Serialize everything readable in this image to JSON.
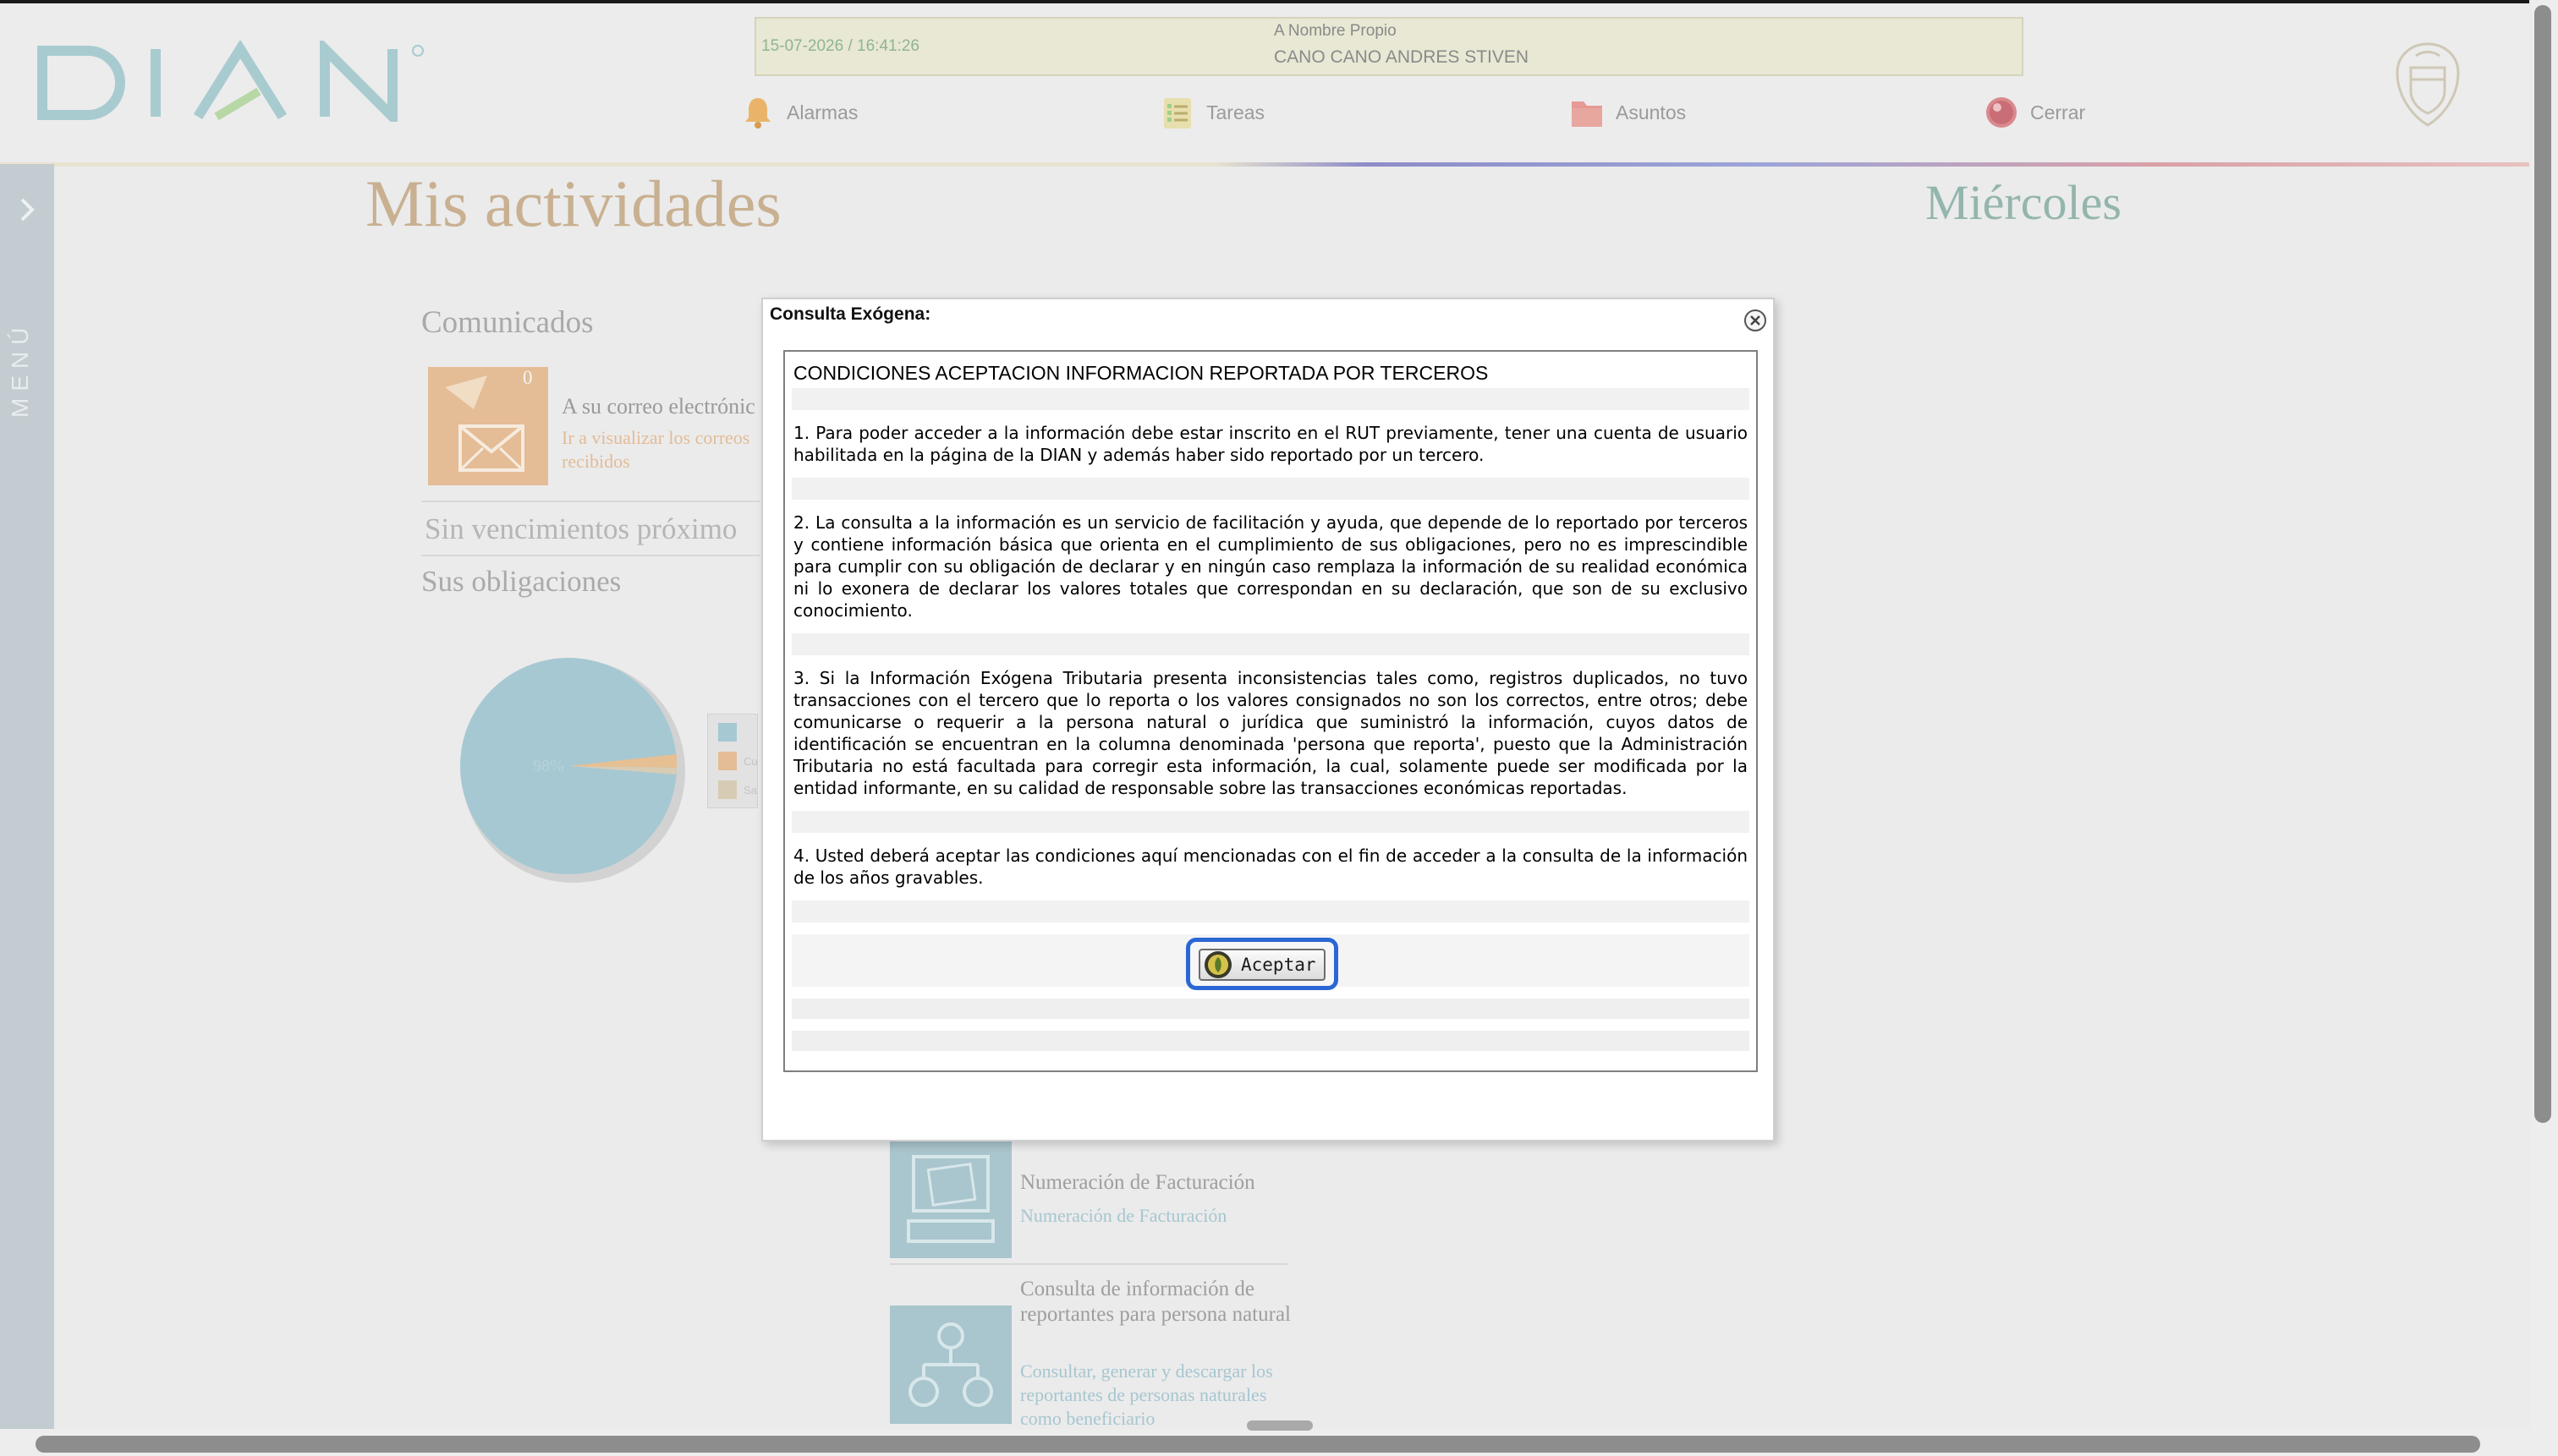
{
  "header": {
    "logo_text": "DIAN",
    "datetime": "15-07-2026 / 16:41:26",
    "role": "A Nombre Propio",
    "user_name": "CANO CANO ANDRES STIVEN",
    "nav": [
      {
        "label": "Alarmas",
        "icon": "bell-icon"
      },
      {
        "label": "Tareas",
        "icon": "checklist-icon"
      },
      {
        "label": "Asuntos",
        "icon": "folder-icon"
      },
      {
        "label": "Cerrar",
        "icon": "power-icon"
      }
    ]
  },
  "sidebar": {
    "label": "MENÚ",
    "icon": "chevron-right-icon"
  },
  "main": {
    "title": "Mis actividades",
    "day": "Miércoles",
    "comunicados": {
      "title": "Comunicados",
      "count": "0",
      "heading": "A su correo electrónic",
      "link": "Ir a visualizar los correos recibidos"
    },
    "sin_vencimientos": "Sin vencimientos próximo",
    "obligaciones": {
      "title": "Sus obligaciones",
      "pie_label": "98%",
      "legend": [
        "",
        "Cu",
        "Sa"
      ]
    },
    "services": [
      {
        "title": "Numeración de Facturación",
        "link": "Numeración de Facturación"
      },
      {
        "title": "Consulta de información de reportantes para persona natural",
        "link": "Consultar, generar y descargar los reportantes de personas naturales como beneficiario"
      }
    ]
  },
  "modal": {
    "title": "Consulta Exógena:",
    "heading": "CONDICIONES ACEPTACION INFORMACION REPORTADA POR TERCEROS",
    "paragraphs": [
      "1. Para poder acceder a la información debe estar inscrito en el RUT previamente, tener una cuenta de usuario habilitada en la página de la DIAN y además haber sido reportado por un tercero.",
      "2. La consulta a la información es un servicio de facilitación y ayuda, que depende de lo reportado por terceros y contiene información básica que orienta en el cumplimiento de sus obligaciones, pero no es imprescindible para cumplir con su obligación de declarar y en ningún caso remplaza la información de su realidad económica ni lo exonera de declarar los valores totales que correspondan en su declaración, que son de su exclusivo conocimiento.",
      "3. Si la Información Exógena Tributaria presenta inconsistencias tales como, registros duplicados, no tuvo transacciones con el tercero que lo reporta o los valores consignados no son los correctos, entre otros; debe comunicarse o requerir a la persona natural o jurídica que suministró la información, cuyos datos de identificación se encuentran en la columna denominada 'persona que reporta', puesto que la Administración Tributaria no está facultada para corregir esta información, la cual, solamente puede ser modificada por la entidad informante, en su calidad de responsable sobre las transacciones económicas reportadas.",
      "4. Usted deberá aceptar las condiciones aquí mencionadas con el fin de acceder a la consulta de la información de los años gravables."
    ],
    "accept_label": "Aceptar",
    "accept_icon": "accept-seal-icon",
    "close_icon": "close-circle-icon"
  },
  "colors": {
    "accent_button_focus": "#2a67d4",
    "page_title": "#c8b091",
    "day_title": "#93b5ad",
    "sidebar": "#c3ccd0"
  }
}
